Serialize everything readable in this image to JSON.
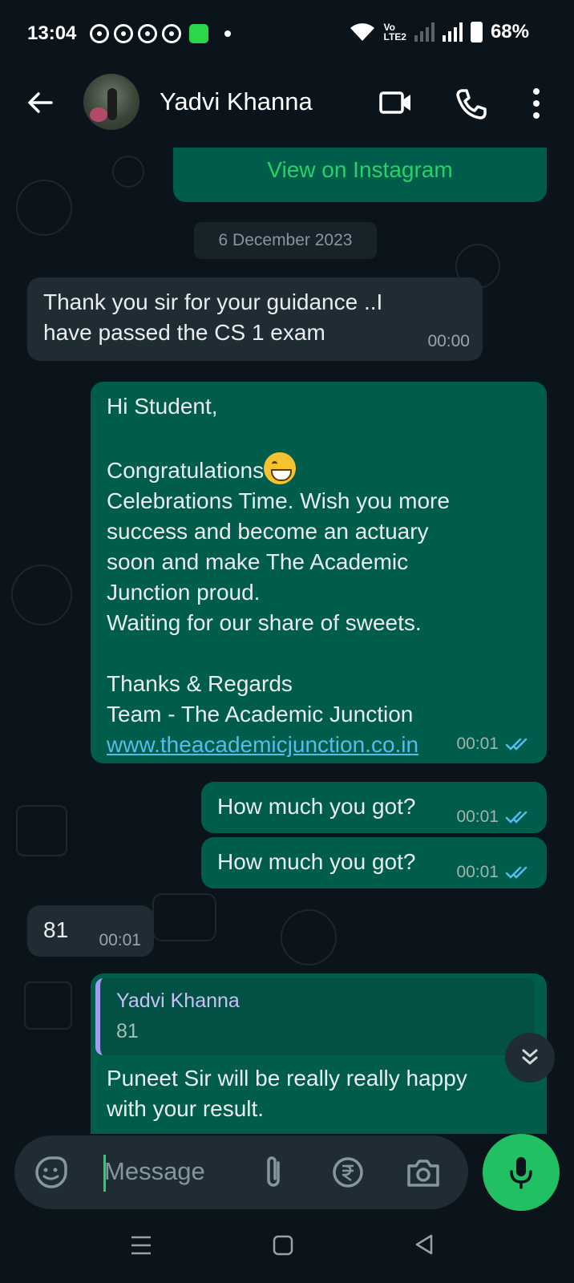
{
  "status_bar": {
    "time": "13:04",
    "network_label": "Vo\nLTE2",
    "battery": "68%"
  },
  "header": {
    "contact_name": "Yadvi Khanna"
  },
  "chat": {
    "instagram_button": "View on Instagram",
    "date_chip": "6 December 2023",
    "messages": [
      {
        "direction": "in",
        "text": "Thank you sir for your guidance ..I\nhave passed the CS 1 exam",
        "time": "00:00"
      },
      {
        "direction": "out",
        "line1": "Hi Student,",
        "line2": "Congratulations",
        "body": "Celebrations Time. Wish you more\nsuccess and become an actuary\nsoon and make The Academic\nJunction proud.\nWaiting for our share of sweets.\n\nThanks & Regards\nTeam - The Academic Junction",
        "link": "www.theacademicjunction.co.in",
        "time": "00:01"
      },
      {
        "direction": "out",
        "text": "How much you got?",
        "time": "00:01"
      },
      {
        "direction": "out",
        "text": "How much you got?",
        "time": "00:01"
      },
      {
        "direction": "in",
        "text": "81",
        "time": "00:01"
      },
      {
        "direction": "out",
        "quote_name": "Yadvi Khanna",
        "quote_text": "81",
        "text": "Puneet Sir will be really really happy\nwith your result."
      }
    ]
  },
  "input": {
    "placeholder": "Message"
  },
  "colors": {
    "background": "#0b141a",
    "incoming_bubble": "#202c33",
    "outgoing_bubble": "#005c4b",
    "accent_green": "#25d366",
    "read_ticks": "#53bdeb"
  },
  "icons": [
    "back-arrow-icon",
    "video-call-icon",
    "phone-icon",
    "more-options-icon",
    "emoji-sticker-icon",
    "attach-icon",
    "rupee-payment-icon",
    "camera-icon",
    "mic-icon",
    "scroll-down-icon",
    "menu-nav-icon",
    "home-nav-icon",
    "back-nav-icon"
  ]
}
